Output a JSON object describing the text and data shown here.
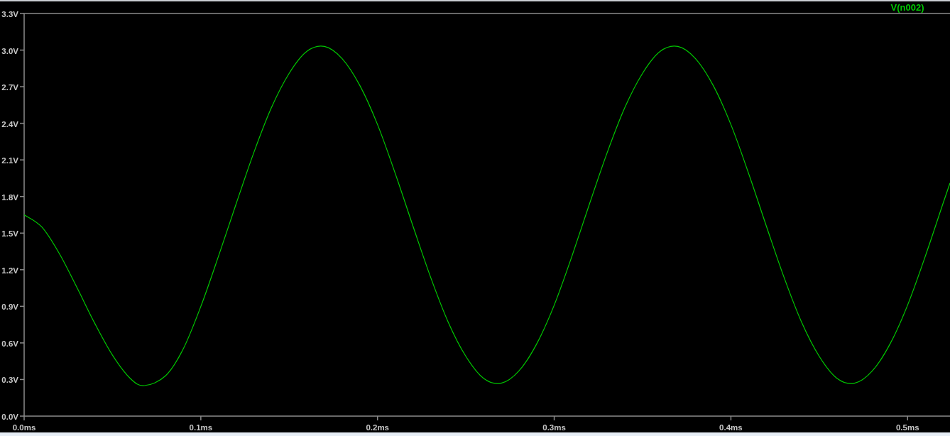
{
  "plot": {
    "chart_data": {
      "type": "line",
      "x": [
        0,
        0.01,
        0.02,
        0.03,
        0.04,
        0.05,
        0.06,
        0.068,
        0.08,
        0.09,
        0.1,
        0.11,
        0.12,
        0.13,
        0.14,
        0.15,
        0.16,
        0.17,
        0.18,
        0.19,
        0.2,
        0.21,
        0.22,
        0.23,
        0.24,
        0.25,
        0.26,
        0.27,
        0.28,
        0.29,
        0.3,
        0.31,
        0.32,
        0.33,
        0.34,
        0.35,
        0.36,
        0.37,
        0.38,
        0.39,
        0.4,
        0.41,
        0.42,
        0.43,
        0.44,
        0.45,
        0.46,
        0.47,
        0.48,
        0.49,
        0.5,
        0.51,
        0.52,
        0.524
      ],
      "series": [
        {
          "name": "V(n002)",
          "color": "#00c800",
          "values": [
            1.65,
            1.55,
            1.33,
            1.05,
            0.76,
            0.5,
            0.31,
            0.25,
            0.33,
            0.55,
            0.9,
            1.31,
            1.74,
            2.16,
            2.53,
            2.81,
            2.99,
            3.03,
            2.93,
            2.71,
            2.39,
            1.99,
            1.56,
            1.14,
            0.77,
            0.49,
            0.31,
            0.27,
            0.37,
            0.59,
            0.91,
            1.31,
            1.74,
            2.16,
            2.53,
            2.81,
            2.99,
            3.03,
            2.93,
            2.71,
            2.39,
            1.99,
            1.56,
            1.14,
            0.77,
            0.49,
            0.31,
            0.27,
            0.37,
            0.59,
            0.91,
            1.31,
            1.74,
            1.91
          ]
        }
      ],
      "xlim": [
        0,
        0.524
      ],
      "ylim": [
        0,
        3.3
      ],
      "xticks": [
        {
          "value": 0,
          "label": "0.0ms"
        },
        {
          "value": 0.1,
          "label": "0.1ms"
        },
        {
          "value": 0.2,
          "label": "0.2ms"
        },
        {
          "value": 0.3,
          "label": "0.3ms"
        },
        {
          "value": 0.4,
          "label": "0.4ms"
        },
        {
          "value": 0.5,
          "label": "0.5ms"
        }
      ],
      "yticks": [
        {
          "value": 0,
          "label": "0.0V"
        },
        {
          "value": 0.3,
          "label": "0.3V"
        },
        {
          "value": 0.6,
          "label": "0.6V"
        },
        {
          "value": 0.9,
          "label": "0.9V"
        },
        {
          "value": 1.2,
          "label": "1.2V"
        },
        {
          "value": 1.5,
          "label": "1.5V"
        },
        {
          "value": 1.8,
          "label": "1.8V"
        },
        {
          "value": 2.1,
          "label": "2.1V"
        },
        {
          "value": 2.4,
          "label": "2.4V"
        },
        {
          "value": 2.7,
          "label": "2.7V"
        },
        {
          "value": 3.0,
          "label": "3.0V"
        },
        {
          "value": 3.3,
          "label": "3.3V"
        }
      ]
    }
  }
}
